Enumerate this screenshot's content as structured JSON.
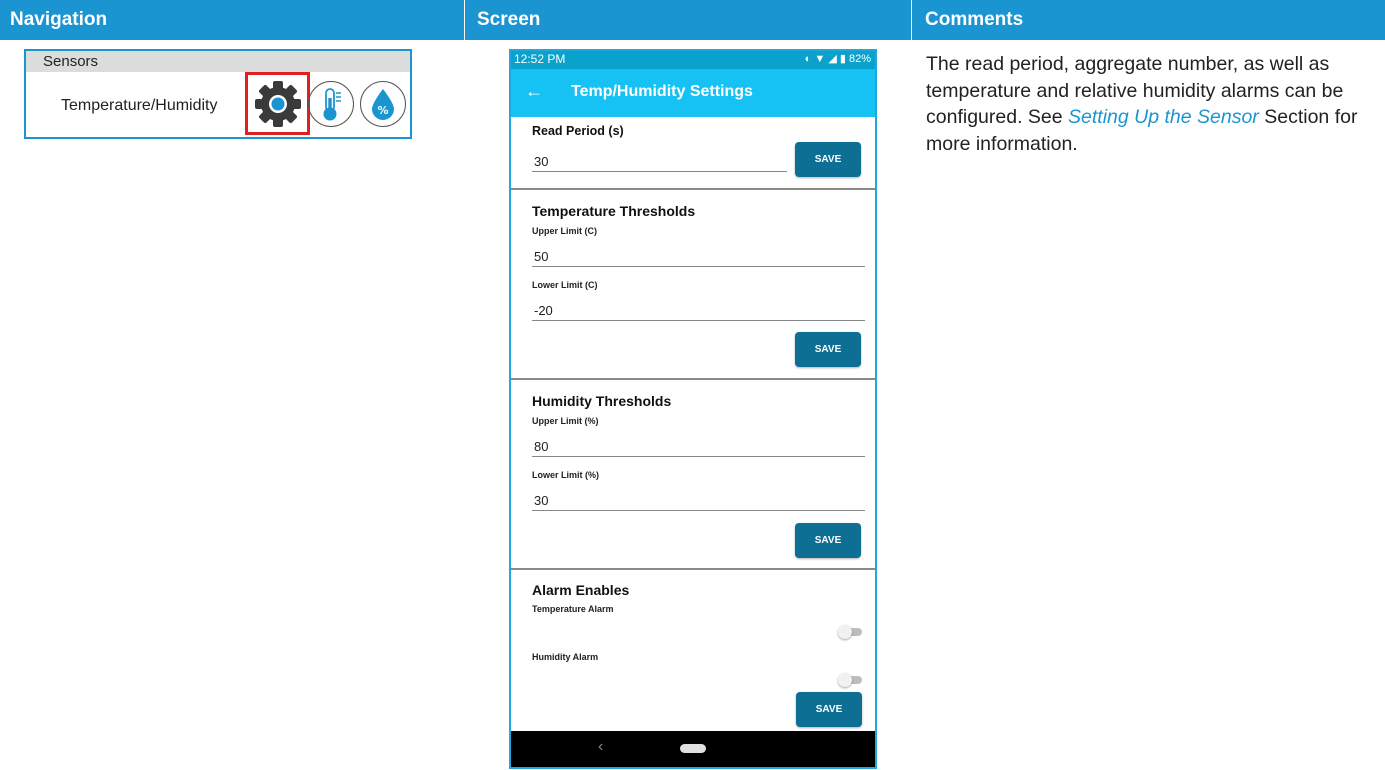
{
  "header": {
    "navigation": "Navigation",
    "screen": "Screen",
    "comments": "Comments"
  },
  "nav_panel": {
    "section": "Sensors",
    "row_label": "Temperature/Humidity",
    "icons": [
      "gear-icon",
      "thermometer-icon",
      "humidity-percent-icon"
    ],
    "highlight_color": "#e02020"
  },
  "phone": {
    "status": {
      "time": "12:52 PM",
      "battery": "82%"
    },
    "title": "Temp/Humidity Settings",
    "read_period": {
      "title": "Read Period (s)",
      "value": "30",
      "save": "SAVE"
    },
    "temperature": {
      "title": "Temperature Thresholds",
      "upper_label": "Upper Limit (C)",
      "upper_value": "50",
      "lower_label": "Lower Limit (C)",
      "lower_value": "-20",
      "save": "SAVE"
    },
    "humidity": {
      "title": "Humidity Thresholds",
      "upper_label": "Upper Limit (%)",
      "upper_value": "80",
      "lower_label": "Lower Limit (%)",
      "lower_value": "30",
      "save": "SAVE"
    },
    "alarms": {
      "title": "Alarm Enables",
      "temp_label": "Temperature Alarm",
      "humidity_label": "Humidity Alarm",
      "temp_enabled": false,
      "humidity_enabled": false,
      "save": "SAVE"
    }
  },
  "comments": {
    "text_before": "The read period, aggregate number, as well as temperature and relative humidity alarms can be configured. See ",
    "link": "Setting Up the Sensor",
    "text_after": " Section for more information."
  },
  "colors": {
    "header_bg": "#1a95d1",
    "appbar": "#15c2f3",
    "status_bar": "#0aa1cd",
    "save_button": "#0e6f95"
  }
}
